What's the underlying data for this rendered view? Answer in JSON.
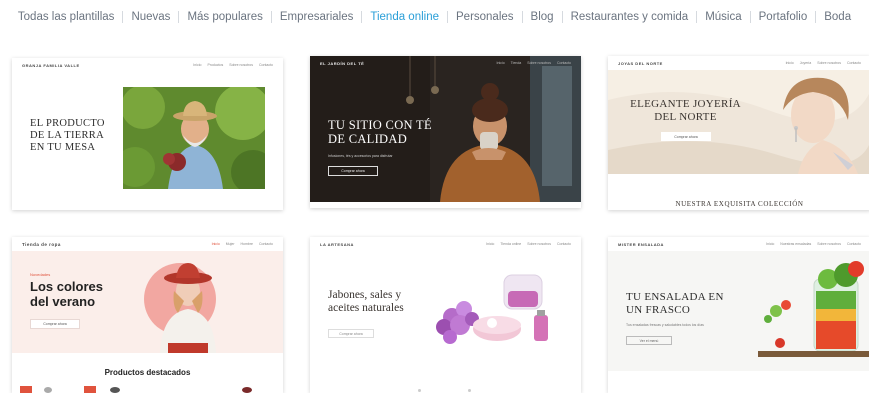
{
  "nav": {
    "items": [
      "Todas las plantillas",
      "Nuevas",
      "Más populares",
      "Empresariales",
      "Tienda online",
      "Personales",
      "Blog",
      "Restaurantes y comida",
      "Música",
      "Portafolio",
      "Boda"
    ],
    "active": "Tienda online"
  },
  "colors": {
    "nav_text": "#6b7480",
    "nav_active": "#2a9fd8",
    "accent_red": "#e0533d"
  },
  "cards": {
    "granja": {
      "logo": "GRANJA FAMILIA VALLE",
      "menu": [
        "Inicio",
        "Productos",
        "Sobre nosotros",
        "Contacto"
      ],
      "title_l1": "EL PRODUCTO",
      "title_l2": "DE LA TIERRA",
      "title_l3": "EN TU MESA"
    },
    "jardin": {
      "logo": "EL JARDÍN DEL TÉ",
      "menu": [
        "Inicio",
        "Tienda",
        "Sobre nosotros",
        "Contacto"
      ],
      "title_l1": "TU SITIO CON TÉ",
      "title_l2": "DE CALIDAD",
      "subtitle": "Infusiones, tés y accesorios para disfrutar",
      "button": "Comprar ahora"
    },
    "joyas": {
      "logo": "JOYAS DEL NORTE",
      "menu": [
        "Inicio",
        "Joyería",
        "Sobre nosotros",
        "Contacto"
      ],
      "title_l1": "ELEGANTE JOYERÍA",
      "title_l2": "DEL NORTE",
      "button": "Comprar ahora",
      "collection": "NUESTRA EXQUISITA COLECCIÓN"
    },
    "ropa": {
      "logo": "Tienda de ropa",
      "menu": [
        "Inicio",
        "Mujer",
        "Hombre",
        "Contacto"
      ],
      "tag": "Novedades",
      "title_l1": "Los colores",
      "title_l2": "del verano",
      "button": "Comprar ahora",
      "featured": "Productos destacados"
    },
    "artesana": {
      "logo": "LA ARTESANA",
      "menu": [
        "Inicio",
        "Tienda online",
        "Sobre nosotros",
        "Contacto"
      ],
      "title_l1": "Jabones, sales y",
      "title_l2": "aceites naturales",
      "button": "Comprar ahora"
    },
    "ensalada": {
      "logo": "MISTER ENSALADA",
      "menu": [
        "Inicio",
        "Nuestras ensaladas",
        "Sobre nosotros",
        "Contacto"
      ],
      "title_l1": "TU ENSALADA EN",
      "title_l2": "UN FRASCO",
      "subtitle": "Tus ensaladas frescas y saludables todos los días",
      "button": "Ver el menú"
    }
  }
}
